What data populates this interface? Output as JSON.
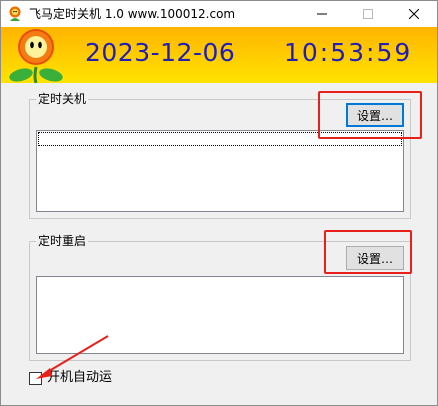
{
  "window": {
    "title": "飞马定时关机 1.0  www.100012.com"
  },
  "banner": {
    "date": "2023-12-06",
    "time": "10:53:59"
  },
  "shutdown_group": {
    "label": "定时关机",
    "settings_button": "设置…"
  },
  "restart_group": {
    "label": "定时重启",
    "settings_button": "设置…"
  },
  "autostart": {
    "label": "开机自动运",
    "checked": false
  },
  "icons": [
    "flower-app-icon",
    "minimize-icon",
    "maximize-icon",
    "close-icon",
    "flower-logo-icon",
    "red-arrow-annotation"
  ],
  "colors": {
    "banner_top": "#ffb400",
    "banner_bottom": "#ffe300",
    "clock_text": "#2020b8",
    "annotation_red": "#e8201c"
  }
}
